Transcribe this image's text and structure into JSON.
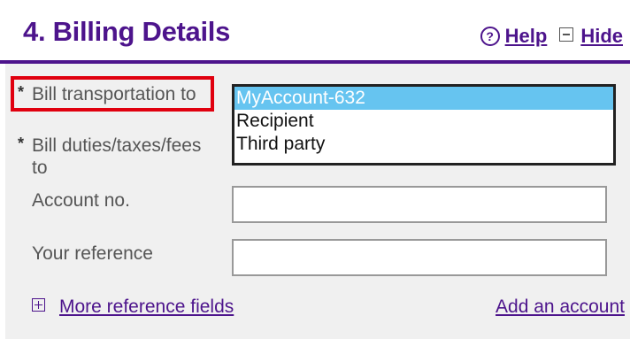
{
  "header": {
    "title": "4. Billing Details",
    "help_label": "Help",
    "hide_label": "Hide",
    "help_icon": "?"
  },
  "form": {
    "bill_transport_label": "Bill transportation to",
    "bill_duties_label": "Bill duties/taxes/fees to",
    "account_no_label": "Account no.",
    "your_reference_label": "Your reference",
    "required_marker": "*",
    "transport_options": [
      "MyAccount-632",
      "Recipient",
      "Third party"
    ],
    "transport_selected": "MyAccount-632",
    "account_no_value": "",
    "your_reference_value": ""
  },
  "footer": {
    "more_reference_label": "More reference fields",
    "add_account_label": "Add an account"
  },
  "colors": {
    "brand_purple": "#4d148c",
    "highlight_red": "#e0000f",
    "selected_option": "#66c4f0"
  }
}
